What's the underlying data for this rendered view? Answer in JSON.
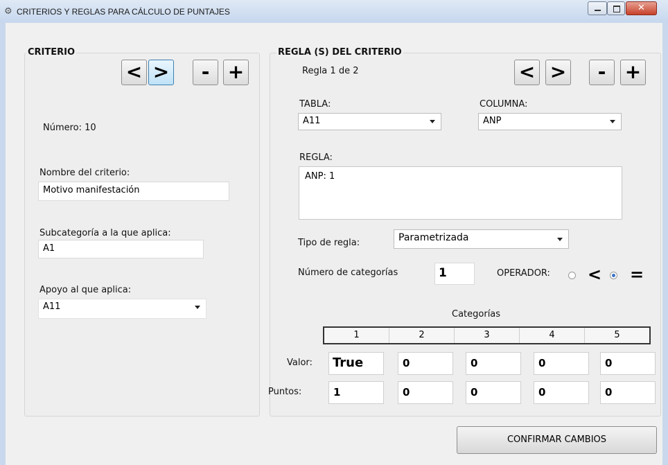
{
  "window": {
    "title": "CRITERIOS Y REGLAS PARA CÁLCULO DE PUNTAJES",
    "icon": "gear-icon"
  },
  "criterio": {
    "group_title": "CRITERIO",
    "prev": "<",
    "next": ">",
    "remove": "-",
    "add": "+",
    "numero_label": "Número: 10",
    "nombre_label": "Nombre del criterio:",
    "nombre_value": "Motivo manifestación",
    "subcategoria_label": "Subcategoría a la que aplica:",
    "subcategoria_value": "A1",
    "apoyo_label": "Apoyo al que aplica:",
    "apoyo_value": "A11"
  },
  "regla": {
    "group_title": "REGLA (S) DEL CRITERIO",
    "counter": "Regla 1 de 2",
    "prev": "<",
    "next": ">",
    "remove": "-",
    "add": "+",
    "tabla_label": "TABLA:",
    "tabla_value": "A11",
    "columna_label": "COLUMNA:",
    "columna_value": "ANP",
    "regla_label": "REGLA:",
    "regla_value": "ANP: 1",
    "tipo_label": "Tipo de regla:",
    "tipo_value": "Parametrizada",
    "num_cat_label": "Número de categorías",
    "num_cat_value": "1",
    "operador_label": "OPERADOR:",
    "op_less": "<",
    "op_equal": "=",
    "op_selected": "="
  },
  "categorias": {
    "title": "Categorías",
    "headers": [
      "1",
      "2",
      "3",
      "4",
      "5"
    ],
    "valor_label": "Valor:",
    "valor": [
      "True",
      "0",
      "0",
      "0",
      "0"
    ],
    "puntos_label": "Puntos:",
    "puntos": [
      "1",
      "0",
      "0",
      "0",
      "0"
    ]
  },
  "confirm_label": "CONFIRMAR CAMBIOS"
}
